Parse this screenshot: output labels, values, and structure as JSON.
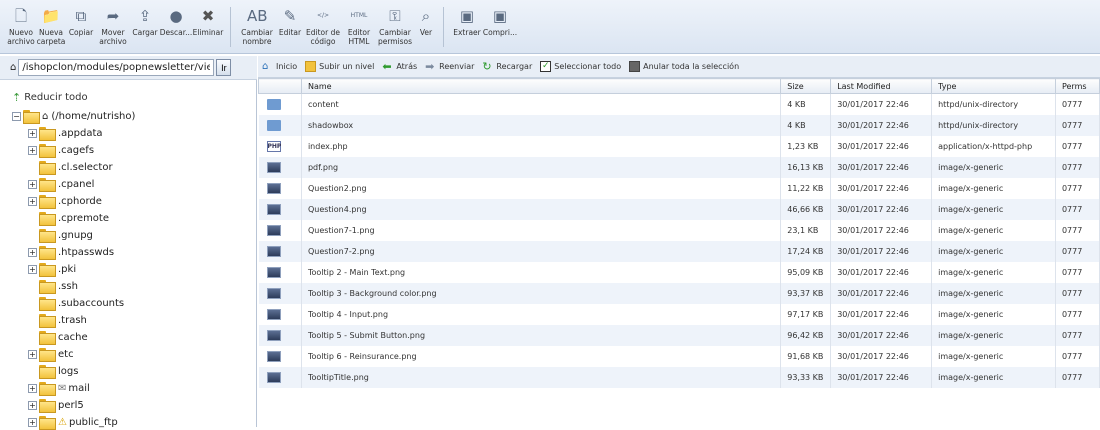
{
  "toolbar": {
    "buttons": [
      {
        "label": "Nuevo\narchivo",
        "icon": "new-file-icon"
      },
      {
        "label": "Nueva\ncarpeta",
        "icon": "new-folder-icon"
      },
      {
        "label": "Copiar",
        "icon": "copy-icon"
      },
      {
        "label": "Mover\narchivo",
        "icon": "move-file-icon"
      },
      {
        "label": "Cargar",
        "icon": "upload-icon"
      },
      {
        "label": "Descar...",
        "icon": "download-icon"
      },
      {
        "label": "Eliminar",
        "icon": "delete-icon"
      },
      {
        "label": "Cambiar\nnombre",
        "icon": "rename-icon"
      },
      {
        "label": "Editar",
        "icon": "edit-icon"
      },
      {
        "label": "Editor de\ncódigo",
        "icon": "code-editor-icon"
      },
      {
        "label": "Editor\nHTML",
        "icon": "html-editor-icon"
      },
      {
        "label": "Cambiar\npermisos",
        "icon": "permissions-icon"
      },
      {
        "label": "Ver",
        "icon": "view-icon"
      },
      {
        "label": "Extraer",
        "icon": "extract-icon"
      },
      {
        "label": "Compri...",
        "icon": "compress-icon"
      }
    ]
  },
  "path": {
    "value": "/ishopclon/modules/popnewsletter/views",
    "go_label": "Ir"
  },
  "sidebar": {
    "collapse_label": "Reducir todo",
    "root_label": "(/home/nutrisho)",
    "items": [
      {
        "label": ".appdata",
        "expandable": true
      },
      {
        "label": ".cagefs",
        "expandable": true
      },
      {
        "label": ".cl.selector",
        "expandable": false
      },
      {
        "label": ".cpanel",
        "expandable": true
      },
      {
        "label": ".cphorde",
        "expandable": true
      },
      {
        "label": ".cpremote",
        "expandable": false
      },
      {
        "label": ".gnupg",
        "expandable": false
      },
      {
        "label": ".htpasswds",
        "expandable": true
      },
      {
        "label": ".pki",
        "expandable": true
      },
      {
        "label": ".ssh",
        "expandable": false
      },
      {
        "label": ".subaccounts",
        "expandable": false
      },
      {
        "label": ".trash",
        "expandable": false
      },
      {
        "label": "cache",
        "expandable": false
      },
      {
        "label": "etc",
        "expandable": true
      },
      {
        "label": "logs",
        "expandable": false
      },
      {
        "label": "mail",
        "expandable": true
      },
      {
        "label": "perl5",
        "expandable": true
      },
      {
        "label": "public_ftp",
        "expandable": true
      }
    ]
  },
  "actions": {
    "home": "Inicio",
    "up": "Subir un nivel",
    "back": "Atrás",
    "forward": "Reenviar",
    "reload": "Recargar",
    "select_all": "Seleccionar todo",
    "deselect_all": "Anular toda la selección"
  },
  "table": {
    "headers": {
      "name": "Name",
      "size": "Size",
      "modified": "Last Modified",
      "type": "Type",
      "perms": "Perms"
    },
    "rows": [
      {
        "icon": "dir",
        "name": "content",
        "size": "4 KB",
        "modified": "30/01/2017 22:46",
        "type": "httpd/unix-directory",
        "perms": "0777"
      },
      {
        "icon": "dir",
        "name": "shadowbox",
        "size": "4 KB",
        "modified": "30/01/2017 22:46",
        "type": "httpd/unix-directory",
        "perms": "0777"
      },
      {
        "icon": "php",
        "name": "index.php",
        "size": "1,23 KB",
        "modified": "30/01/2017 22:46",
        "type": "application/x-httpd-php",
        "perms": "0777"
      },
      {
        "icon": "img",
        "name": "pdf.png",
        "size": "16,13 KB",
        "modified": "30/01/2017 22:46",
        "type": "image/x-generic",
        "perms": "0777"
      },
      {
        "icon": "img",
        "name": "Question2.png",
        "size": "11,22 KB",
        "modified": "30/01/2017 22:46",
        "type": "image/x-generic",
        "perms": "0777"
      },
      {
        "icon": "img",
        "name": "Question4.png",
        "size": "46,66 KB",
        "modified": "30/01/2017 22:46",
        "type": "image/x-generic",
        "perms": "0777"
      },
      {
        "icon": "img",
        "name": "Question7-1.png",
        "size": "23,1 KB",
        "modified": "30/01/2017 22:46",
        "type": "image/x-generic",
        "perms": "0777"
      },
      {
        "icon": "img",
        "name": "Question7-2.png",
        "size": "17,24 KB",
        "modified": "30/01/2017 22:46",
        "type": "image/x-generic",
        "perms": "0777"
      },
      {
        "icon": "img",
        "name": "Tooltip 2 - Main Text.png",
        "size": "95,09 KB",
        "modified": "30/01/2017 22:46",
        "type": "image/x-generic",
        "perms": "0777"
      },
      {
        "icon": "img",
        "name": "Tooltip 3 - Background color.png",
        "size": "93,37 KB",
        "modified": "30/01/2017 22:46",
        "type": "image/x-generic",
        "perms": "0777"
      },
      {
        "icon": "img",
        "name": "Tooltip 4 - Input.png",
        "size": "97,17 KB",
        "modified": "30/01/2017 22:46",
        "type": "image/x-generic",
        "perms": "0777"
      },
      {
        "icon": "img",
        "name": "Tooltip 5 - Submit Button.png",
        "size": "96,42 KB",
        "modified": "30/01/2017 22:46",
        "type": "image/x-generic",
        "perms": "0777"
      },
      {
        "icon": "img",
        "name": "Tooltip 6 - Reinsurance.png",
        "size": "91,68 KB",
        "modified": "30/01/2017 22:46",
        "type": "image/x-generic",
        "perms": "0777"
      },
      {
        "icon": "img",
        "name": "TooltipTitle.png",
        "size": "93,33 KB",
        "modified": "30/01/2017 22:46",
        "type": "image/x-generic",
        "perms": "0777"
      }
    ]
  }
}
